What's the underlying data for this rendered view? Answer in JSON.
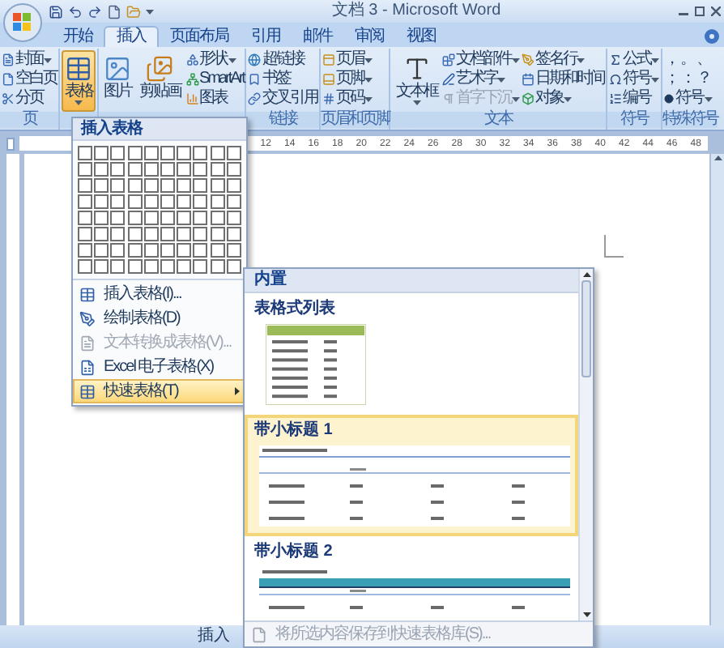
{
  "window": {
    "title": "文档 3 - Microsoft Word"
  },
  "tabs": [
    {
      "label": "开始",
      "selected": false
    },
    {
      "label": "插入",
      "selected": true
    },
    {
      "label": "页面布局",
      "selected": false
    },
    {
      "label": "引用",
      "selected": false
    },
    {
      "label": "邮件",
      "selected": false
    },
    {
      "label": "审阅",
      "selected": false
    },
    {
      "label": "视图",
      "selected": false
    }
  ],
  "ribbon": {
    "groups": [
      {
        "kind": "buttons",
        "label": "页",
        "columns": [
          [
            {
              "label": "封面",
              "kind": "small",
              "dropdown": true,
              "pressed": false,
              "disabled": false
            },
            {
              "label": "空白页",
              "kind": "small",
              "dropdown": false,
              "pressed": false,
              "disabled": false
            },
            {
              "label": "分页",
              "kind": "small",
              "dropdown": false,
              "pressed": false,
              "disabled": false
            }
          ]
        ]
      },
      {
        "kind": "buttons",
        "columns": [
          [
            {
              "label": "表格",
              "kind": "large",
              "dropdown": true,
              "pressed": true,
              "disabled": false
            }
          ]
        ]
      },
      {
        "kind": "buttons",
        "columns": [
          [
            {
              "label": "图片",
              "kind": "large",
              "dropdown": false,
              "pressed": false,
              "disabled": false
            }
          ],
          [
            {
              "label": "剪贴画",
              "kind": "large",
              "dropdown": false,
              "pressed": false,
              "disabled": false
            }
          ],
          [
            {
              "label": "形状",
              "kind": "small",
              "dropdown": true,
              "pressed": false,
              "disabled": false
            },
            {
              "label": "SmartArt",
              "kind": "small",
              "dropdown": false,
              "pressed": false,
              "disabled": false
            },
            {
              "label": "图表",
              "kind": "small",
              "dropdown": false,
              "pressed": false,
              "disabled": false
            }
          ]
        ]
      },
      {
        "kind": "buttons",
        "label": "链接",
        "columns": [
          [
            {
              "label": "超链接",
              "kind": "small",
              "dropdown": false,
              "pressed": false,
              "disabled": false
            },
            {
              "label": "书签",
              "kind": "small",
              "dropdown": false,
              "pressed": false,
              "disabled": false
            },
            {
              "label": "交叉引用",
              "kind": "small",
              "dropdown": false,
              "pressed": false,
              "disabled": false
            }
          ]
        ]
      },
      {
        "kind": "buttons",
        "label": "页眉和页脚",
        "columns": [
          [
            {
              "label": "页眉",
              "kind": "small",
              "dropdown": true,
              "pressed": false,
              "disabled": false
            },
            {
              "label": "页脚",
              "kind": "small",
              "dropdown": true,
              "pressed": false,
              "disabled": false
            },
            {
              "label": "页码",
              "kind": "small",
              "dropdown": true,
              "pressed": false,
              "disabled": false
            }
          ]
        ]
      },
      {
        "kind": "buttons",
        "label": "文本",
        "columns": [
          [
            {
              "label": "文本框",
              "kind": "large",
              "dropdown": true,
              "pressed": false,
              "disabled": false
            }
          ],
          [
            {
              "label": "文档部件",
              "kind": "small",
              "dropdown": true,
              "pressed": false,
              "disabled": false
            },
            {
              "label": "艺术字",
              "kind": "small",
              "dropdown": true,
              "pressed": false,
              "disabled": false
            },
            {
              "label": "首字下沉",
              "kind": "small",
              "dropdown": true,
              "pressed": false,
              "disabled": true
            }
          ],
          [
            {
              "label": "签名行",
              "kind": "small",
              "dropdown": true,
              "pressed": false,
              "disabled": false
            },
            {
              "label": "日期和时间",
              "kind": "small",
              "dropdown": false,
              "pressed": false,
              "disabled": false
            },
            {
              "label": "对象",
              "kind": "small",
              "dropdown": true,
              "pressed": false,
              "disabled": false
            }
          ]
        ]
      },
      {
        "kind": "buttons",
        "label": "符号",
        "columns": [
          [
            {
              "label": "公式",
              "kind": "small",
              "dropdown": true,
              "pressed": false,
              "disabled": false
            },
            {
              "label": "符号",
              "kind": "small",
              "dropdown": true,
              "pressed": false,
              "disabled": false
            },
            {
              "label": "编号",
              "kind": "small",
              "dropdown": false,
              "pressed": false,
              "disabled": false
            }
          ]
        ]
      },
      {
        "kind": "symbols",
        "label": "特殊符号",
        "rows": [
          [
            "，",
            "。",
            "、"
          ],
          [
            "；",
            "：",
            "？"
          ]
        ],
        "more": {
          "label": "符号",
          "dropdown": true
        }
      }
    ]
  },
  "ruler": {
    "numbers": [
      "12",
      "14",
      "16",
      "18",
      "20",
      "22",
      "24",
      "26",
      "28",
      "30",
      "32",
      "34",
      "36",
      "38",
      "40",
      "42",
      "44",
      "46",
      "48"
    ]
  },
  "table_menu": {
    "header": "插入表格",
    "items": [
      {
        "label": "插入表格(I)...",
        "disabled": false,
        "selected": false,
        "submenu": false
      },
      {
        "label": "绘制表格(D)",
        "disabled": false,
        "selected": false,
        "submenu": false
      },
      {
        "label": "文本转换成表格(V)...",
        "disabled": true,
        "selected": false,
        "submenu": false
      },
      {
        "label": "Excel 电子表格(X)",
        "disabled": false,
        "selected": false,
        "submenu": false
      },
      {
        "label": "快速表格(T)",
        "disabled": false,
        "selected": true,
        "submenu": true
      }
    ]
  },
  "quick_tables": {
    "header": "内置",
    "sections": [
      {
        "title": "表格式列表",
        "kind": "list",
        "selected": false
      },
      {
        "title": "带小标题 1",
        "kind": "plain",
        "selected": true
      },
      {
        "title": "带小标题 2",
        "kind": "banded",
        "selected": false
      }
    ],
    "footer": {
      "label": "将所选内容保存到快速表格库(S)...",
      "disabled": true
    }
  },
  "status_bar": {
    "mode": "插入"
  }
}
